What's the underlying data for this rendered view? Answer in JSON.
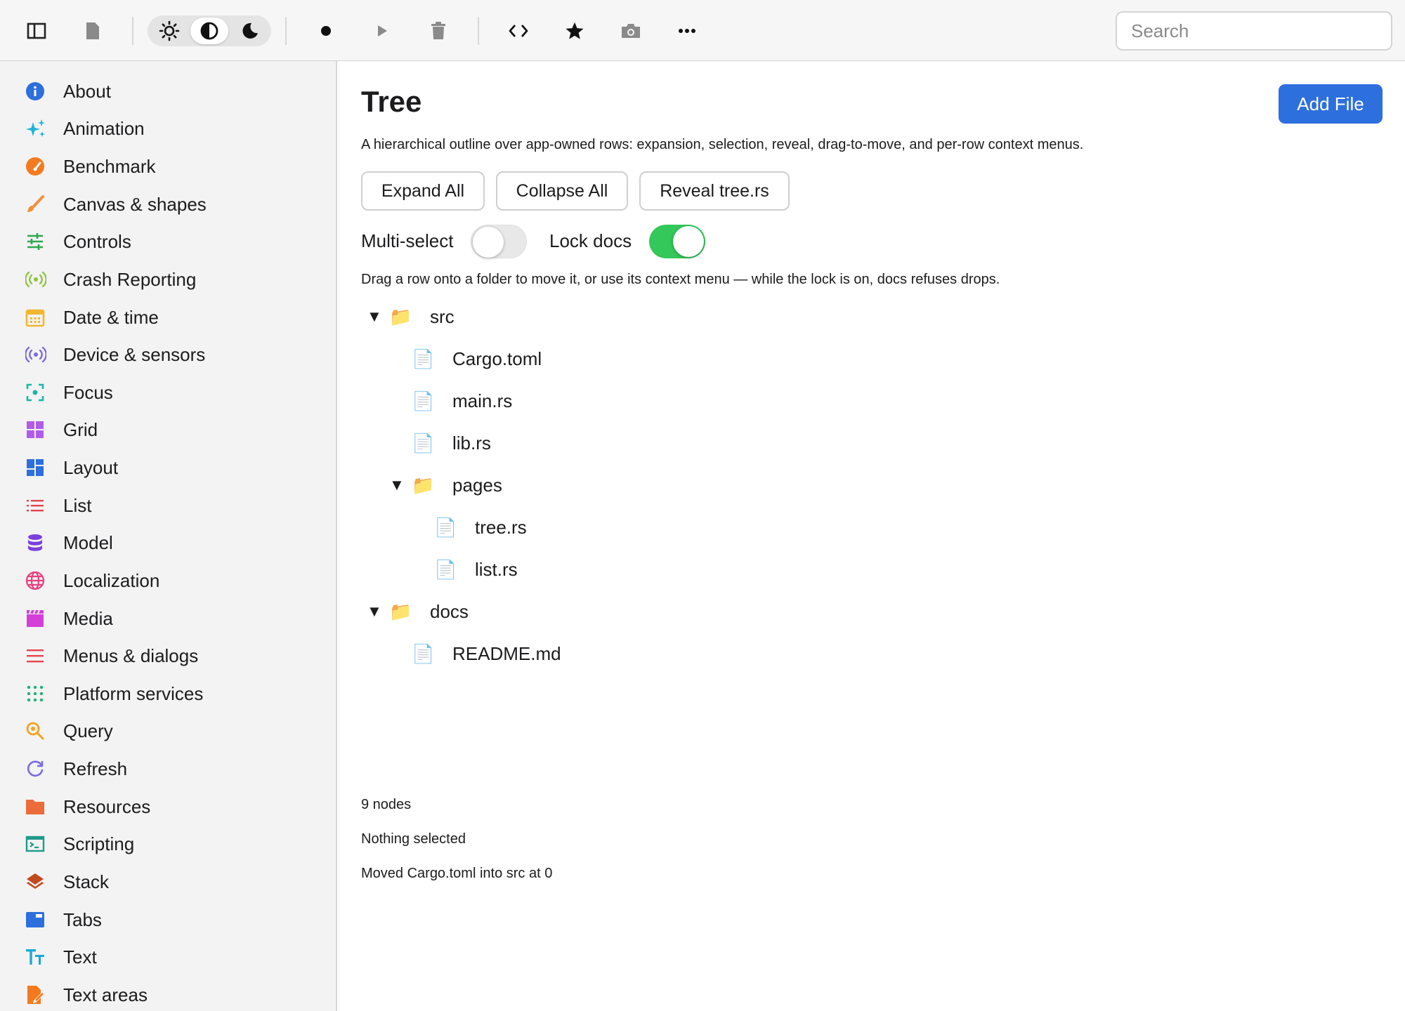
{
  "toolbar": {
    "search_placeholder": "Search",
    "buttons": [
      "sidebar-toggle-icon",
      "document-icon",
      "record-icon",
      "play-icon",
      "trash-icon",
      "code-icon",
      "star-icon",
      "camera-icon",
      "more-icon"
    ],
    "theme_options": [
      "light",
      "contrast",
      "dark"
    ],
    "theme_selected": "contrast"
  },
  "sidebar": {
    "items": [
      {
        "label": "About",
        "icon": "info-icon",
        "color": "#2d6fdc"
      },
      {
        "label": "Animation",
        "icon": "sparkles-icon",
        "color": "#19b5d8"
      },
      {
        "label": "Benchmark",
        "icon": "gauge-icon",
        "color": "#f47a1f"
      },
      {
        "label": "Canvas & shapes",
        "icon": "brush-icon",
        "color": "#f0913a"
      },
      {
        "label": "Controls",
        "icon": "sliders-icon",
        "color": "#2fa84f"
      },
      {
        "label": "Crash Reporting",
        "icon": "broadcast-icon",
        "color": "#8bc53f"
      },
      {
        "label": "Date & time",
        "icon": "calendar-icon",
        "color": "#f2b731"
      },
      {
        "label": "Device & sensors",
        "icon": "sensor-icon",
        "color": "#7a6ae0"
      },
      {
        "label": "Focus",
        "icon": "focus-icon",
        "color": "#1fb5a6"
      },
      {
        "label": "Grid",
        "icon": "grid-icon",
        "color": "#b05ce8"
      },
      {
        "label": "Layout",
        "icon": "layout-icon",
        "color": "#2d6fdc"
      },
      {
        "label": "List",
        "icon": "list-icon",
        "color": "#e8434f"
      },
      {
        "label": "Model",
        "icon": "database-icon",
        "color": "#7b3fe0"
      },
      {
        "label": "Localization",
        "icon": "globe-icon",
        "color": "#e8407f"
      },
      {
        "label": "Media",
        "icon": "clapper-icon",
        "color": "#d43fd8"
      },
      {
        "label": "Menus & dialogs",
        "icon": "menu-icon",
        "color": "#e8434f"
      },
      {
        "label": "Platform services",
        "icon": "dots-grid-icon",
        "color": "#22b07a"
      },
      {
        "label": "Query",
        "icon": "magnifier-icon",
        "color": "#f2a21f"
      },
      {
        "label": "Refresh",
        "icon": "refresh-icon",
        "color": "#7a6ae0"
      },
      {
        "label": "Resources",
        "icon": "folder-icon",
        "color": "#ec6b3a"
      },
      {
        "label": "Scripting",
        "icon": "terminal-icon",
        "color": "#1f9b8a"
      },
      {
        "label": "Stack",
        "icon": "stack-icon",
        "color": "#c24a1f"
      },
      {
        "label": "Tabs",
        "icon": "tabs-icon",
        "color": "#2d6fdc"
      },
      {
        "label": "Text",
        "icon": "text-icon",
        "color": "#19a9d8"
      },
      {
        "label": "Text areas",
        "icon": "text-area-icon",
        "color": "#f47a1f"
      }
    ]
  },
  "main": {
    "title": "Tree",
    "add_file": "Add File",
    "description": "A hierarchical outline over app-owned rows: expansion, selection, reveal, drag-to-move, and per-row context menus.",
    "buttons": {
      "expand_all": "Expand All",
      "collapse_all": "Collapse All",
      "reveal": "Reveal tree.rs"
    },
    "toggles": {
      "multi_select_label": "Multi-select",
      "multi_select_on": false,
      "lock_docs_label": "Lock docs",
      "lock_docs_on": true
    },
    "hint": "Drag a row onto a folder to move it, or use its context menu — while the lock is on, docs refuses drops.",
    "tree": [
      {
        "label": "src",
        "kind": "folder",
        "depth": 0,
        "expanded": true
      },
      {
        "label": "Cargo.toml",
        "kind": "file",
        "depth": 1
      },
      {
        "label": "main.rs",
        "kind": "file",
        "depth": 1
      },
      {
        "label": "lib.rs",
        "kind": "file",
        "depth": 1
      },
      {
        "label": "pages",
        "kind": "folder",
        "depth": 1,
        "expanded": true
      },
      {
        "label": "tree.rs",
        "kind": "file",
        "depth": 2
      },
      {
        "label": "list.rs",
        "kind": "file",
        "depth": 2
      },
      {
        "label": "docs",
        "kind": "folder",
        "depth": 0,
        "expanded": true
      },
      {
        "label": "README.md",
        "kind": "file",
        "depth": 1
      }
    ],
    "status": {
      "count": "9 nodes",
      "selection": "Nothing selected",
      "last_action": "Moved Cargo.toml into src at 0"
    }
  }
}
